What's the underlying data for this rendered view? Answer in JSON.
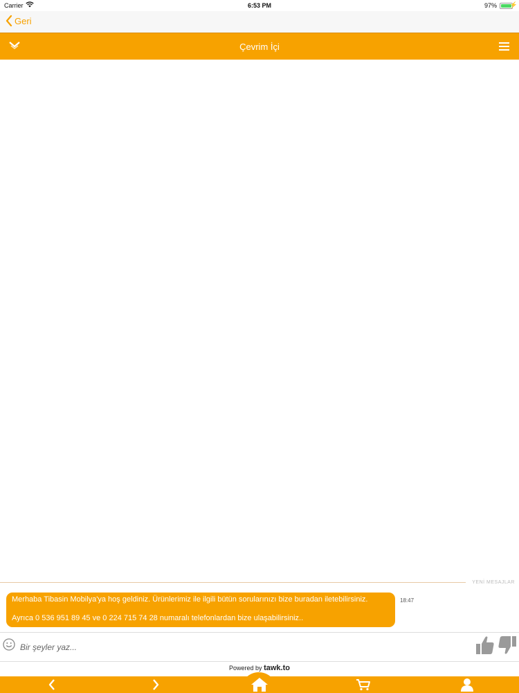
{
  "status_bar": {
    "carrier": "Carrier",
    "time": "6:53 PM",
    "battery": "97%",
    "battery_level": 0.97
  },
  "nav": {
    "back_label": "Geri"
  },
  "chat_header": {
    "title": "Çevrim İçi"
  },
  "chat": {
    "new_messages_label": "YENİ MESAJLAR",
    "message": {
      "line1": "Merhaba Tibasin Mobilya'ya hoş geldiniz. Ürünlerimiz ile ilgili bütün sorularınızı bize buradan iletebilirsiniz.",
      "line2": "Ayrıca 0 536 951 89 45 ve 0 224 715 74 28 numaralı telefonlardan bize ulaşabilirsiniz..",
      "time": "18:47"
    }
  },
  "input": {
    "placeholder": "Bir şeyler yaz..."
  },
  "powered": {
    "prefix": "Powered by",
    "brand": "tawk.to"
  },
  "colors": {
    "accent": "#f7a200",
    "icon_gray": "#9a9a9a"
  },
  "icons": [
    "wifi-icon",
    "chevron-left-icon",
    "chevron-down-icon",
    "hamburger-menu-icon",
    "smiley-icon",
    "thumbs-up-icon",
    "thumbs-down-icon",
    "arrow-left-icon",
    "arrow-right-icon",
    "home-icon",
    "cart-icon",
    "user-icon"
  ]
}
